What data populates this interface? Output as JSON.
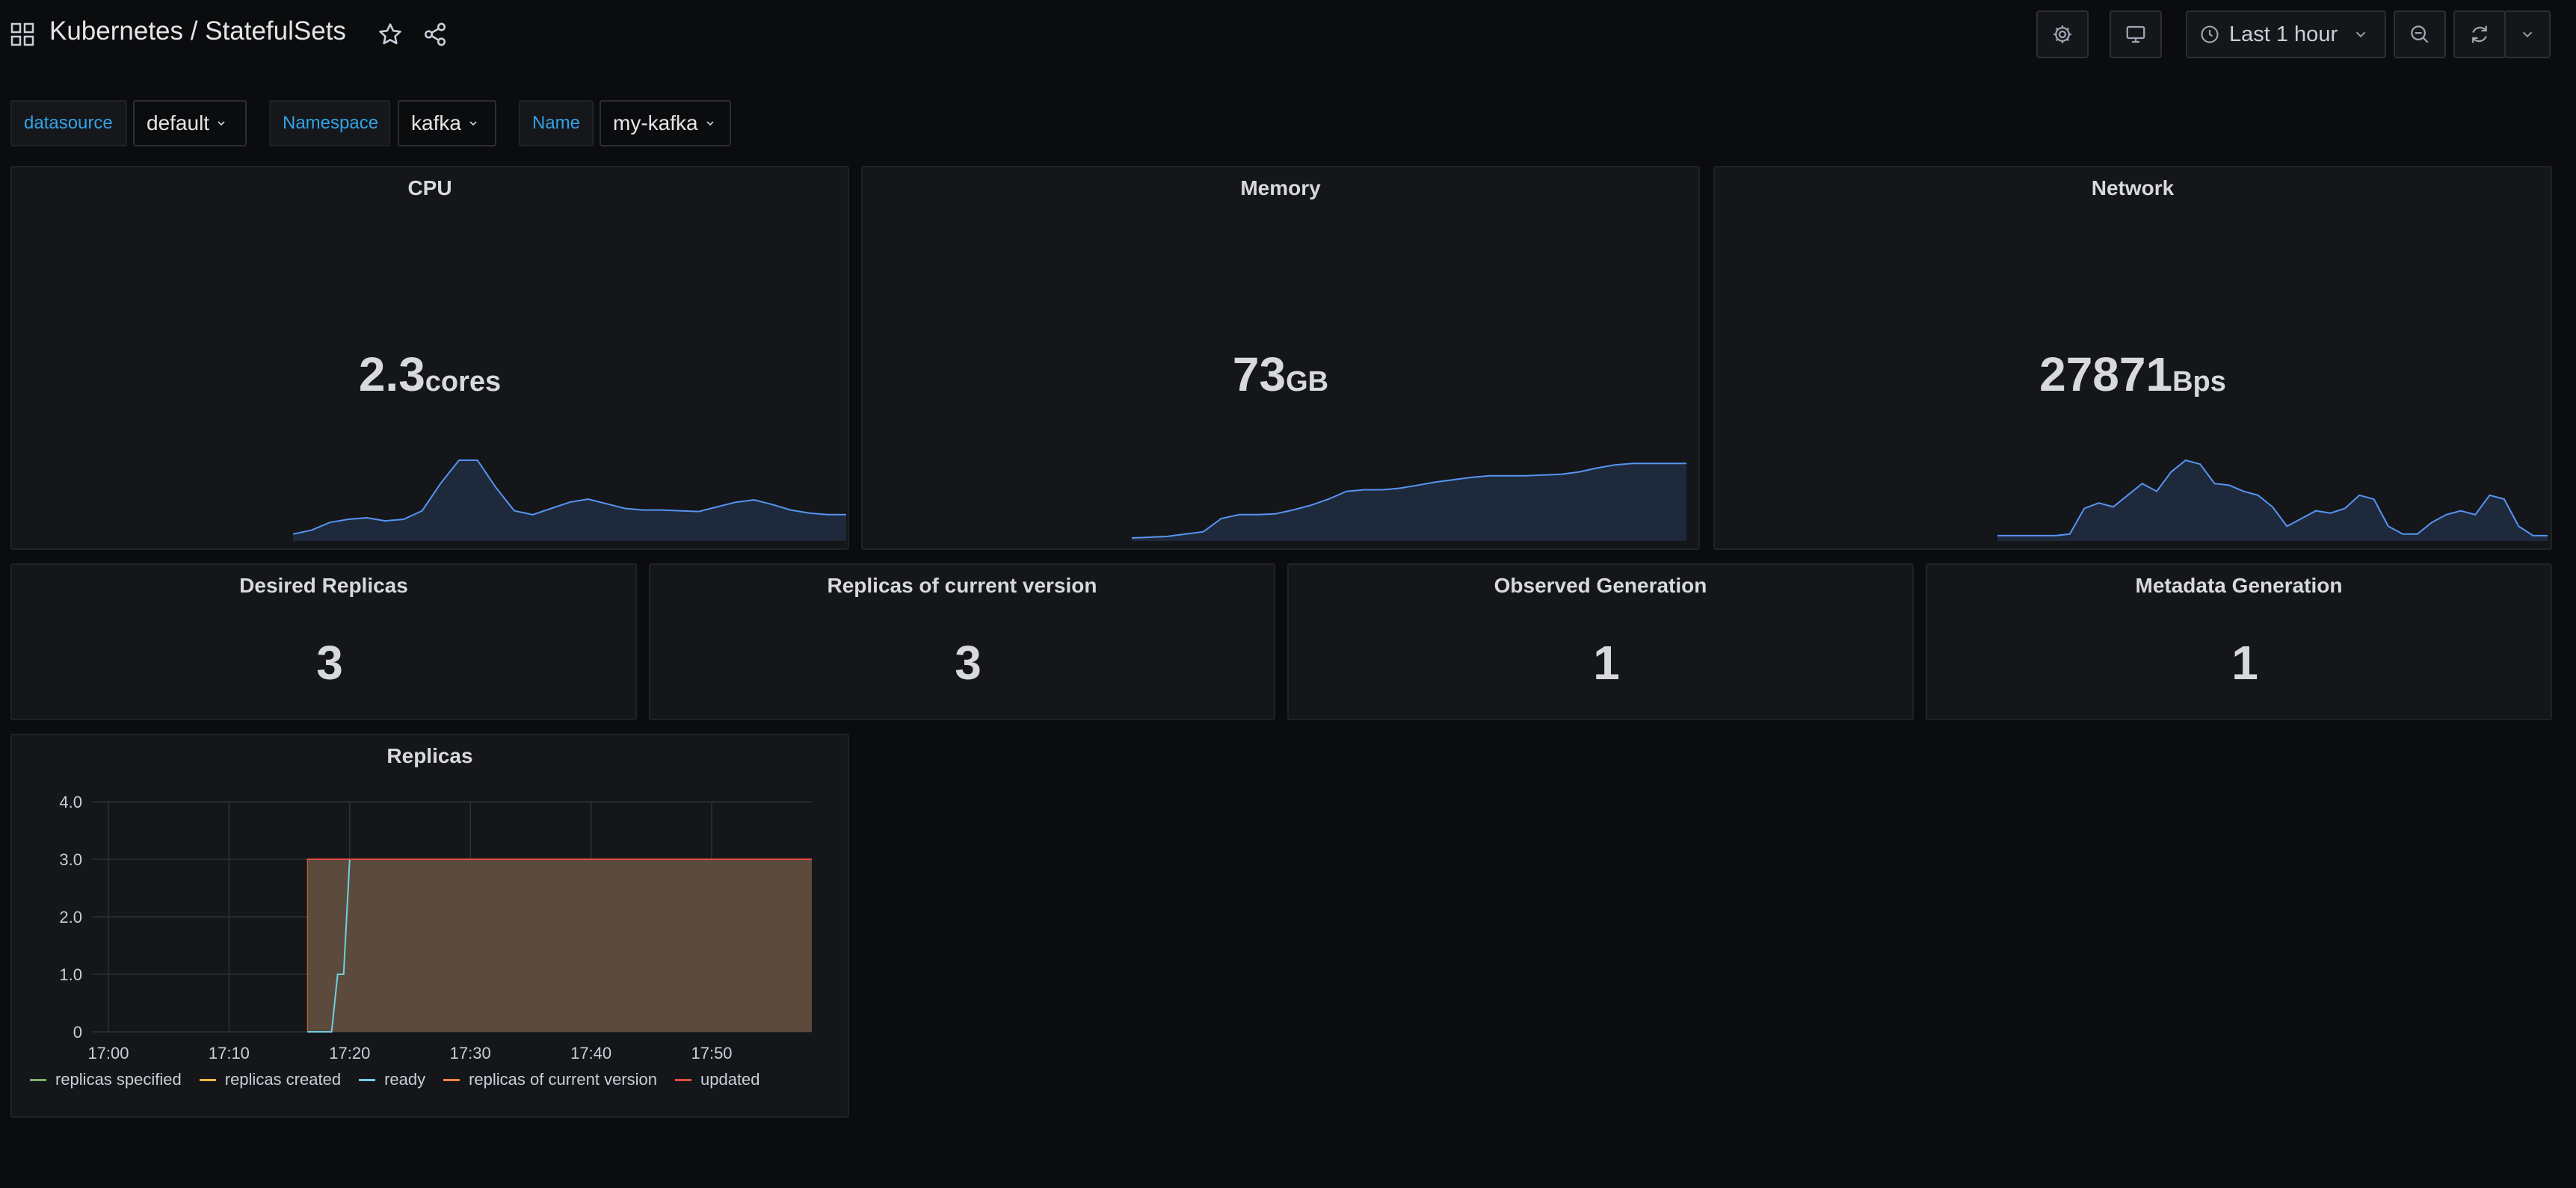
{
  "header": {
    "title": "Kubernetes / StatefulSets",
    "time_range": "Last 1 hour"
  },
  "variables": [
    {
      "label": "datasource",
      "value": "default"
    },
    {
      "label": "Namespace",
      "value": "kafka"
    },
    {
      "label": "Name",
      "value": "my-kafka"
    }
  ],
  "stats": {
    "cpu": {
      "title": "CPU",
      "value": "2.3",
      "unit": "cores"
    },
    "memory": {
      "title": "Memory",
      "value": "73",
      "unit": "GB"
    },
    "network": {
      "title": "Network",
      "value": "27871",
      "unit": "Bps"
    },
    "desired_replicas": {
      "title": "Desired Replicas",
      "value": "3"
    },
    "replicas_current": {
      "title": "Replicas of current version",
      "value": "3"
    },
    "observed_generation": {
      "title": "Observed Generation",
      "value": "1"
    },
    "metadata_generation": {
      "title": "Metadata Generation",
      "value": "1"
    }
  },
  "colors": {
    "accent": "#33a2e5",
    "spark_line": "#5794f2",
    "spark_fill": "#1f2c40",
    "area_fill": "#5c4b3c",
    "replicas_specified": "#7eb26d",
    "replicas_created": "#eab839",
    "ready": "#6ed0e0",
    "replicas_current": "#ef843c",
    "updated": "#e24d42"
  },
  "replicas_panel": {
    "title": "Replicas",
    "legend": [
      {
        "name": "replicas specified",
        "color": "#7eb26d"
      },
      {
        "name": "replicas created",
        "color": "#eab839"
      },
      {
        "name": "ready",
        "color": "#6ed0e0"
      },
      {
        "name": "replicas of current version",
        "color": "#ef843c"
      },
      {
        "name": "updated",
        "color": "#e24d42"
      }
    ]
  },
  "chart_data": [
    {
      "type": "area",
      "name": "cpu-sparkline",
      "y": [
        0.05,
        0.1,
        0.2,
        0.24,
        0.26,
        0.22,
        0.24,
        0.35,
        0.7,
        1.0,
        1.0,
        0.65,
        0.35,
        0.3,
        0.38,
        0.46,
        0.5,
        0.44,
        0.38,
        0.36,
        0.36,
        0.35,
        0.34,
        0.4,
        0.46,
        0.49,
        0.43,
        0.36,
        0.32,
        0.3,
        0.3
      ]
    },
    {
      "type": "area",
      "name": "memory-sparkline",
      "y": [
        0.0,
        0.01,
        0.02,
        0.05,
        0.08,
        0.25,
        0.3,
        0.3,
        0.31,
        0.36,
        0.42,
        0.5,
        0.6,
        0.62,
        0.62,
        0.64,
        0.68,
        0.72,
        0.75,
        0.78,
        0.8,
        0.8,
        0.8,
        0.81,
        0.82,
        0.85,
        0.9,
        0.94,
        0.96,
        0.96,
        0.96,
        0.96
      ]
    },
    {
      "type": "area",
      "name": "network-sparkline",
      "y": [
        0.03,
        0.03,
        0.03,
        0.03,
        0.03,
        0.05,
        0.38,
        0.45,
        0.4,
        0.55,
        0.7,
        0.6,
        0.85,
        1.0,
        0.95,
        0.7,
        0.68,
        0.6,
        0.55,
        0.4,
        0.15,
        0.25,
        0.35,
        0.32,
        0.38,
        0.55,
        0.5,
        0.15,
        0.05,
        0.05,
        0.2,
        0.3,
        0.35,
        0.3,
        0.55,
        0.5,
        0.15,
        0.03,
        0.03
      ]
    },
    {
      "type": "line",
      "name": "replicas",
      "title": "Replicas",
      "x_ticks": [
        "17:00",
        "17:10",
        "17:20",
        "17:30",
        "17:40",
        "17:50"
      ],
      "y_ticks": [
        "0",
        "1.0",
        "2.0",
        "3.0",
        "4.0"
      ],
      "ylim": [
        0,
        4
      ],
      "xlim_minutes": [
        -1.3,
        58.3
      ],
      "grid": true,
      "legend_position": "bottom",
      "series": [
        {
          "name": "replicas specified",
          "x_minutes": [
            16.5,
            58.3
          ],
          "values": [
            3,
            3
          ]
        },
        {
          "name": "replicas created",
          "x_minutes": [
            16.5,
            58.3
          ],
          "values": [
            3,
            3
          ]
        },
        {
          "name": "ready",
          "x_minutes": [
            16.5,
            18.5,
            19.0,
            19.5,
            20.0,
            58.3
          ],
          "values": [
            0,
            0,
            1,
            1,
            3,
            3
          ]
        },
        {
          "name": "replicas of current version",
          "x_minutes": [
            16.5,
            58.3
          ],
          "values": [
            3,
            3
          ]
        },
        {
          "name": "updated",
          "x_minutes": [
            16.5,
            58.3
          ],
          "values": [
            3,
            3
          ]
        }
      ]
    }
  ]
}
